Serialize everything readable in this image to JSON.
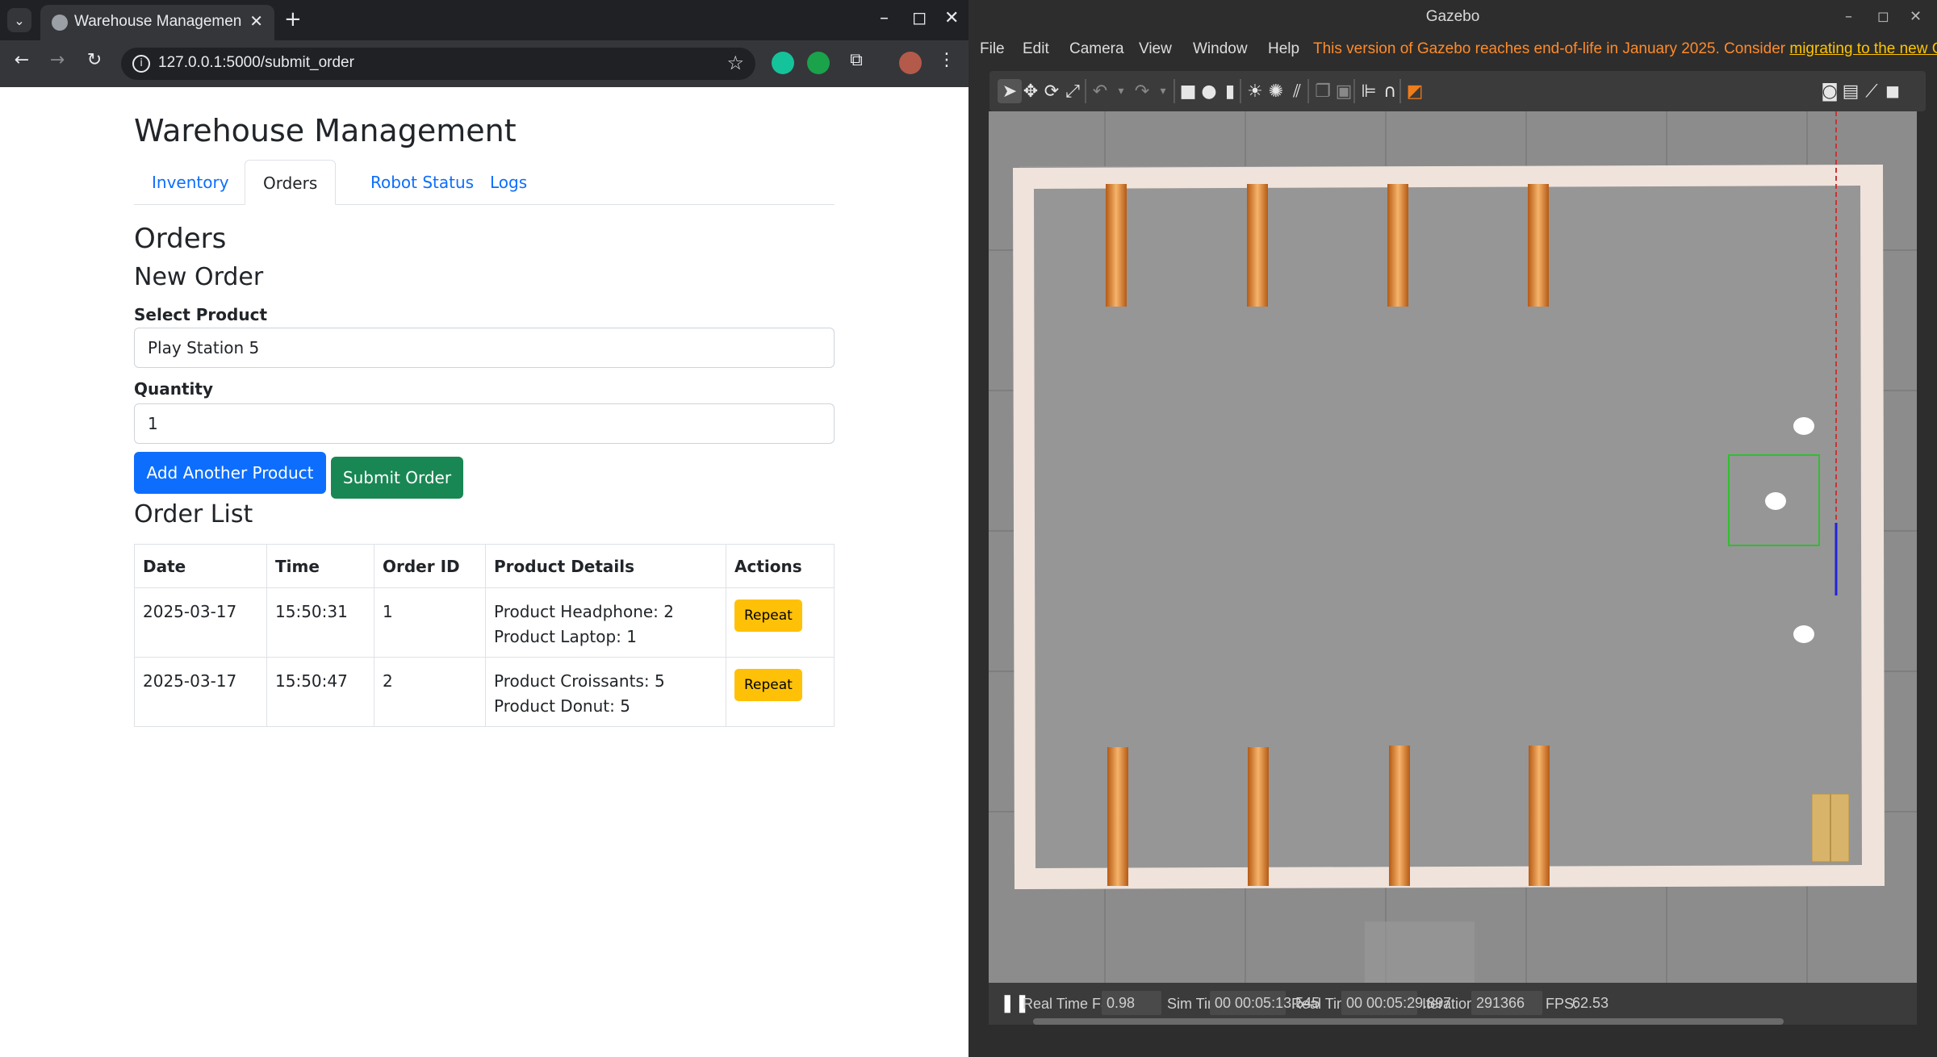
{
  "browser": {
    "tab_title": "Warehouse Managemen",
    "url": "127.0.0.1:5000/submit_order"
  },
  "app": {
    "title": "Warehouse Management",
    "tabs": [
      "Inventory",
      "Orders",
      "Robot Status",
      "Logs"
    ],
    "active_tab": "Orders",
    "section_title": "Orders",
    "new_order": {
      "heading": "New Order",
      "product_label": "Select Product",
      "product_value": "Play Station 5",
      "quantity_label": "Quantity",
      "quantity_value": "1",
      "add_button": "Add Another Product",
      "submit_button": "Submit Order"
    },
    "order_list": {
      "heading": "Order List",
      "columns": [
        "Date",
        "Time",
        "Order ID",
        "Product Details",
        "Actions"
      ],
      "rows": [
        {
          "date": "2025-03-17",
          "time": "15:50:31",
          "id": "1",
          "details": [
            "Product Headphone: 2",
            "Product Laptop: 1"
          ],
          "action": "Repeat"
        },
        {
          "date": "2025-03-17",
          "time": "15:50:47",
          "id": "2",
          "details": [
            "Product Croissants: 5",
            "Product Donut: 5"
          ],
          "action": "Repeat"
        }
      ]
    },
    "colors": {
      "primary": "#0d6efd",
      "success": "#198754",
      "warning": "#ffc107"
    }
  },
  "gazebo": {
    "title": "Gazebo",
    "menu": [
      "File",
      "Edit",
      "Camera",
      "View",
      "Window",
      "Help"
    ],
    "warning_text": "This version of Gazebo reaches end-of-life in January 2025. Consider ",
    "warning_link": "migrating to the new G",
    "toolbar_icons": [
      "select-icon",
      "translate-icon",
      "rotate-icon",
      "scale-icon",
      "undo-icon",
      "undo-dropdown-icon",
      "redo-icon",
      "redo-dropdown-icon",
      "box-icon",
      "sphere-icon",
      "cylinder-icon",
      "point-light-icon",
      "spot-light-icon",
      "directional-light-icon",
      "copy-icon",
      "paste-icon",
      "align-icon",
      "snap-icon",
      "view-angle-icon",
      "screenshot-icon",
      "log-icon",
      "plot-icon",
      "record-icon"
    ],
    "status": {
      "rtf_label": "Real Time Factor:",
      "rtf_value": "0.98",
      "sim_label": "Sim Time:",
      "sim_value": "00 00:05:13.545",
      "real_label": "Real Time:",
      "real_value": "00 00:05:29.897",
      "iter_label": "Iterations:",
      "iter_value": "291366",
      "fps_label": "FPS:",
      "fps_value": "62.53"
    }
  }
}
